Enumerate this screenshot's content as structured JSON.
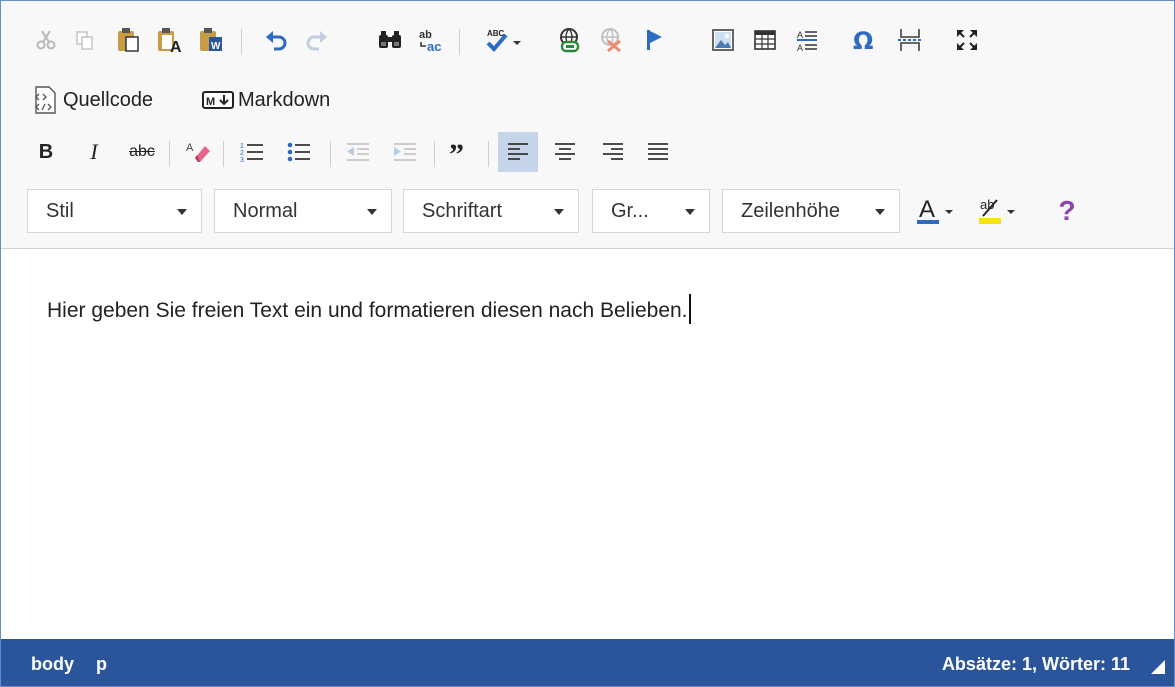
{
  "toolbar": {
    "row2": {
      "source_label": "Quellcode",
      "markdown_label": "Markdown"
    },
    "combos": {
      "style": "Stil",
      "format": "Normal",
      "font": "Schriftart",
      "size": "Gr...",
      "lineheight": "Zeilenhöhe"
    },
    "help_label": "?",
    "bold_label": "B",
    "italic_label": "I",
    "strike_label": "abc"
  },
  "content": {
    "text": "Hier geben Sie freien Text ein und formatieren diesen nach Belieben."
  },
  "statusbar": {
    "path": [
      "body",
      "p"
    ],
    "counts": "Absätze: 1, Wörter: 11"
  },
  "colors": {
    "statusbar": "#2b559a",
    "accent_blue": "#2d6bc2",
    "help_purple": "#8e44ad",
    "highlight_yellow": "#f5e400"
  }
}
